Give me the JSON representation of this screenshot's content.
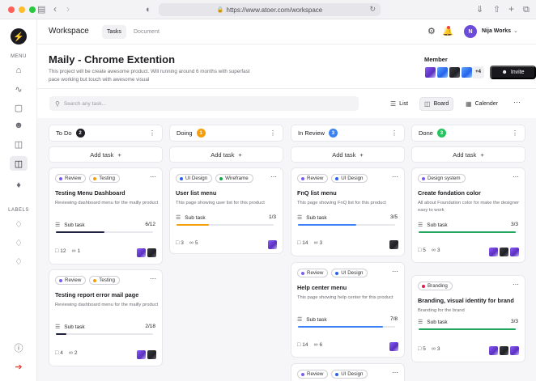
{
  "browser": {
    "url": "https://www.atoer.com/workspace"
  },
  "sidebar": {
    "menu_label": "MENU",
    "labels_label": "LABELS"
  },
  "header": {
    "workspace_title": "Workspace",
    "tabs": [
      {
        "label": "Tasks"
      },
      {
        "label": "Document"
      }
    ],
    "user": {
      "name": "Nija Works",
      "initials": "N"
    }
  },
  "project": {
    "title": "Maily - Chrome Extention",
    "description": "This project will be create awesome product. Will running around 6 months with superfast pace working but touch with awesome visual",
    "member_label": "Member",
    "more_members": "+4",
    "invite_label": "Invite"
  },
  "toolbar": {
    "search_placeholder": "Search any task...",
    "views": [
      {
        "label": "List"
      },
      {
        "label": "Board"
      },
      {
        "label": "Calender"
      }
    ]
  },
  "board": {
    "add_task_label": "Add task",
    "columns": [
      {
        "name": "To Do",
        "count": "2",
        "color": "#1f1f25",
        "cards": [
          {
            "chips": [
              {
                "label": "Review",
                "color": "#7c5cf0"
              },
              {
                "label": "Testing",
                "color": "#f59e0b"
              }
            ],
            "title": "Testing Menu Dashboard",
            "desc": "Reviewing dashboard menu for the mailly product",
            "subtask_label": "Sub task",
            "subtask_value": "6/12",
            "progress": 0.5,
            "bar_color": "#1f2340",
            "comments": "12",
            "links": "1"
          },
          {
            "chips": [
              {
                "label": "Review",
                "color": "#7c5cf0"
              },
              {
                "label": "Testing",
                "color": "#f59e0b"
              }
            ],
            "title": "Testing report error mail page",
            "desc": "Reviewing dashboard menu for the mailly product",
            "subtask_label": "Sub task",
            "subtask_value": "2/18",
            "progress": 0.11,
            "bar_color": "#1f2340",
            "comments": "4",
            "links": "2"
          }
        ]
      },
      {
        "name": "Doing",
        "count": "1",
        "color": "#f59e0b",
        "cards": [
          {
            "chips": [
              {
                "label": "UI Design",
                "color": "#2563eb"
              },
              {
                "label": "Wireframe",
                "color": "#16a34a"
              }
            ],
            "title": "User list menu",
            "desc": "This page showing user list for this product",
            "subtask_label": "Sub task",
            "subtask_value": "1/3",
            "progress": 0.33,
            "bar_color": "#f59e0b",
            "comments": "3",
            "links": "5"
          }
        ]
      },
      {
        "name": "In Review",
        "count": "3",
        "color": "#3b82f6",
        "cards": [
          {
            "chips": [
              {
                "label": "Review",
                "color": "#7c5cf0"
              },
              {
                "label": "UI Design",
                "color": "#2563eb"
              }
            ],
            "title": "FnQ list menu",
            "desc": "This page showing FnQ list for this product",
            "subtask_label": "Sub task",
            "subtask_value": "3/5",
            "progress": 0.6,
            "bar_color": "#3b82f6",
            "comments": "14",
            "links": "3"
          },
          {
            "chips": [
              {
                "label": "Review",
                "color": "#7c5cf0"
              },
              {
                "label": "UI Design",
                "color": "#2563eb"
              }
            ],
            "title": "Help center menu",
            "desc": "This page showing help center for this product",
            "subtask_label": "Sub task",
            "subtask_value": "7/8",
            "progress": 0.875,
            "bar_color": "#3b82f6",
            "comments": "14",
            "links": "6"
          },
          {
            "chips": [
              {
                "label": "Review",
                "color": "#7c5cf0"
              },
              {
                "label": "UI Design",
                "color": "#2563eb"
              }
            ]
          }
        ]
      },
      {
        "name": "Done",
        "count": "3",
        "color": "#22c55e",
        "cards": [
          {
            "chips": [
              {
                "label": "Design system",
                "color": "#7c5cf0"
              }
            ],
            "title": "Create fondation color",
            "desc": "All about Foundation color for make the designer easy to work",
            "subtask_label": "Sub task",
            "subtask_value": "3/3",
            "progress": 1,
            "bar_color": "#22a55e",
            "comments": "5",
            "links": "3"
          },
          {
            "chips": [
              {
                "label": "Branding",
                "color": "#e11d48"
              }
            ],
            "title": "Branding, visual identity for brand",
            "desc": "Branding for the brand",
            "subtask_label": "Sub task",
            "subtask_value": "3/3",
            "progress": 1,
            "bar_color": "#22a55e",
            "comments": "5",
            "links": "3"
          }
        ]
      }
    ]
  },
  "colors": {
    "accent": "#18181d",
    "board_bg": "#f6f6f8"
  },
  "icons": {
    "sidebar": [
      "home-icon",
      "activity-icon",
      "box-icon",
      "users-icon",
      "folder-icon",
      "board-icon",
      "tag-icon"
    ],
    "labels": [
      "tag-icon",
      "tag-icon",
      "tag-icon"
    ]
  }
}
